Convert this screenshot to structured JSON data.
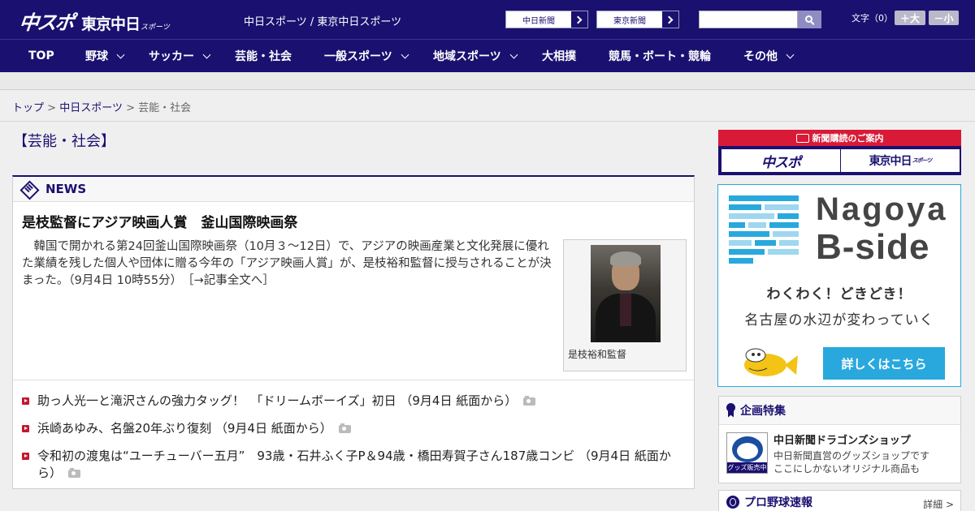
{
  "header": {
    "logo_main": "中スポ",
    "logo_sub": "東京中日",
    "logo_small": "スポーツ",
    "site_line": "中日スポーツ / 東京中日スポーツ",
    "paper_buttons": [
      "中日新聞",
      "東京新聞"
    ],
    "search_placeholder": "",
    "font_size_label": "文字（0）",
    "font_bigger": "＋大",
    "font_smaller": "－小"
  },
  "nav": {
    "items": [
      {
        "label": "TOP",
        "dropdown": false
      },
      {
        "label": "野球",
        "dropdown": true
      },
      {
        "label": "サッカー",
        "dropdown": true
      },
      {
        "label": "芸能・社会",
        "dropdown": false
      },
      {
        "label": "一般スポーツ",
        "dropdown": true
      },
      {
        "label": "地域スポーツ",
        "dropdown": true
      },
      {
        "label": "大相撲",
        "dropdown": false
      },
      {
        "label": "競馬・ボート・競輪",
        "dropdown": false
      },
      {
        "label": "その他",
        "dropdown": true
      }
    ]
  },
  "breadcrumb": {
    "items": [
      "トップ",
      "中日スポーツ",
      "芸能・社会"
    ],
    "separator": ">"
  },
  "main": {
    "section_title": "【芸能・社会】",
    "news_label": "NEWS",
    "top_story": {
      "headline": "是枝監督にアジア映画人賞　釜山国際映画祭",
      "lead": "韓国で開かれる第24回釜山国際映画祭（10月３～12日）で、アジアの映画産業と文化発展に優れた業績を残した個人や団体に贈る今年の「アジア映画人賞」が、是枝裕和監督に授与されることが決まった。（9月4日 10時55分）",
      "more_link": "［→記事全文へ］",
      "photo_caption": "是枝裕和監督"
    },
    "list": [
      {
        "text": "助っ人光一と滝沢さんの強力タッグ！　「ドリームボーイズ」初日 （9月4日 紙面から）",
        "has_photo": true
      },
      {
        "text": "浜崎あゆみ、名盤20年ぶり復刻 （9月4日 紙面から）",
        "has_photo": true
      },
      {
        "text": "令和初の渡鬼は“ユーチューバー五月”　93歳・石井ふく子P＆94歳・橋田寿賀子さん187歳コンビ （9月4日 紙面から）",
        "has_photo": true
      }
    ]
  },
  "sidebar": {
    "subscribe_title": "新聞購読のご案内",
    "subscribe_buttons": [
      "中スポ",
      "東京中日"
    ],
    "subscribe_small": "スポーツ",
    "ad": {
      "title1": "Nagoya",
      "title2": "B-side",
      "copy1": "わくわく！どきどき！",
      "copy2": "名古屋の水辺が変わっていく",
      "cta": "詳しくはこちら"
    },
    "feature": {
      "title": "企画特集",
      "thumb_label": "グッズ販売中",
      "item_title": "中日新聞ドラゴンズショップ",
      "line1": "中日新聞直営のグッズショップです",
      "line2": "ここにしかないオリジナル商品も"
    },
    "pro_baseball": {
      "title": "プロ野球速報",
      "more": "詳細 >"
    }
  },
  "colors": {
    "brand_navy": "#1a1070",
    "accent_red": "#c4182f",
    "ad_blue": "#29a8dd"
  }
}
